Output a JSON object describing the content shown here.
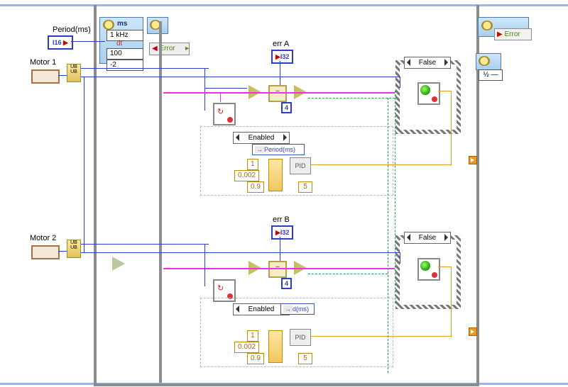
{
  "labels": {
    "period": "Period(ms)",
    "motor1": "Motor 1",
    "motor2": "Motor 2",
    "errA": "err A",
    "errB": "err B"
  },
  "timing": {
    "unit": "ms",
    "freq": "1 kHz",
    "dt_label": "dt",
    "dt": "100",
    "offset": "-2"
  },
  "terminals": {
    "i16": "I16",
    "i32": "I32",
    "error_in": "Error",
    "error_out": "Error"
  },
  "constants": {
    "four": "4",
    "five": "5",
    "Kp": "1",
    "Ki": "0.002",
    "Kd": "0.9"
  },
  "selectors": {
    "case_false": "False",
    "enabled": "Enabled",
    "period_item": "Period(ms)",
    "period_item_short": "d(ms)"
  },
  "nodes": {
    "pid": "PID",
    "eq": "=",
    "lt": "<",
    "half_tick": "½",
    "half_tick2": "½"
  }
}
